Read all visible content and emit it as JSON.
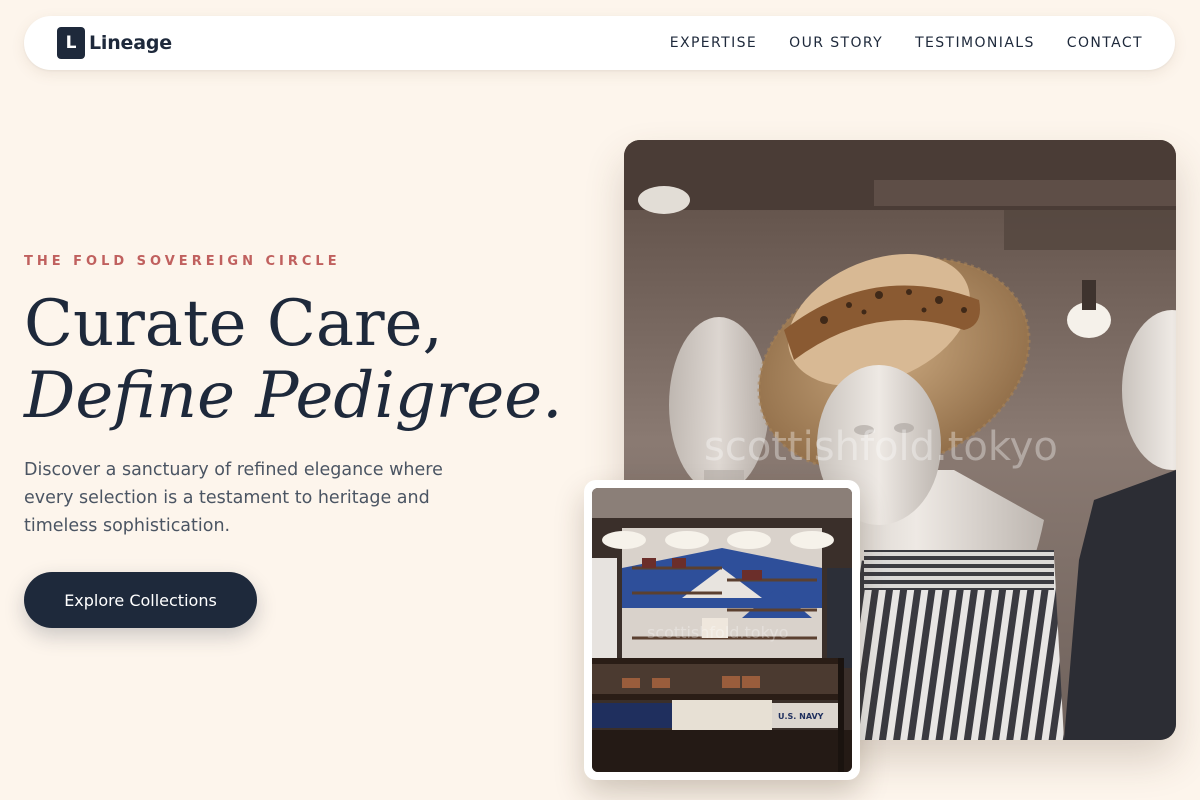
{
  "brand": {
    "logo_letter": "L",
    "name": "Lineage"
  },
  "nav": {
    "items": [
      "EXPERTISE",
      "OUR STORY",
      "TESTIMONIALS",
      "CONTACT"
    ]
  },
  "hero": {
    "eyebrow": "THE FOLD SOVEREIGN CIRCLE",
    "headline_line1": "Curate Care,",
    "headline_line2": "Define Pedigree.",
    "description": "Discover a sanctuary of refined elegance where every selection is a testament to heritage and timeless sophistication.",
    "cta_label": "Explore Collections"
  },
  "images": {
    "main_watermark": "scottishfold.tokyo",
    "small_watermark": "scottishfold.tokyo",
    "shelf_tag": "U.S. NAVY"
  },
  "colors": {
    "background": "#fdf5ec",
    "primary": "#1e293b",
    "accent": "#c0605e",
    "body_text": "#4b5563"
  }
}
